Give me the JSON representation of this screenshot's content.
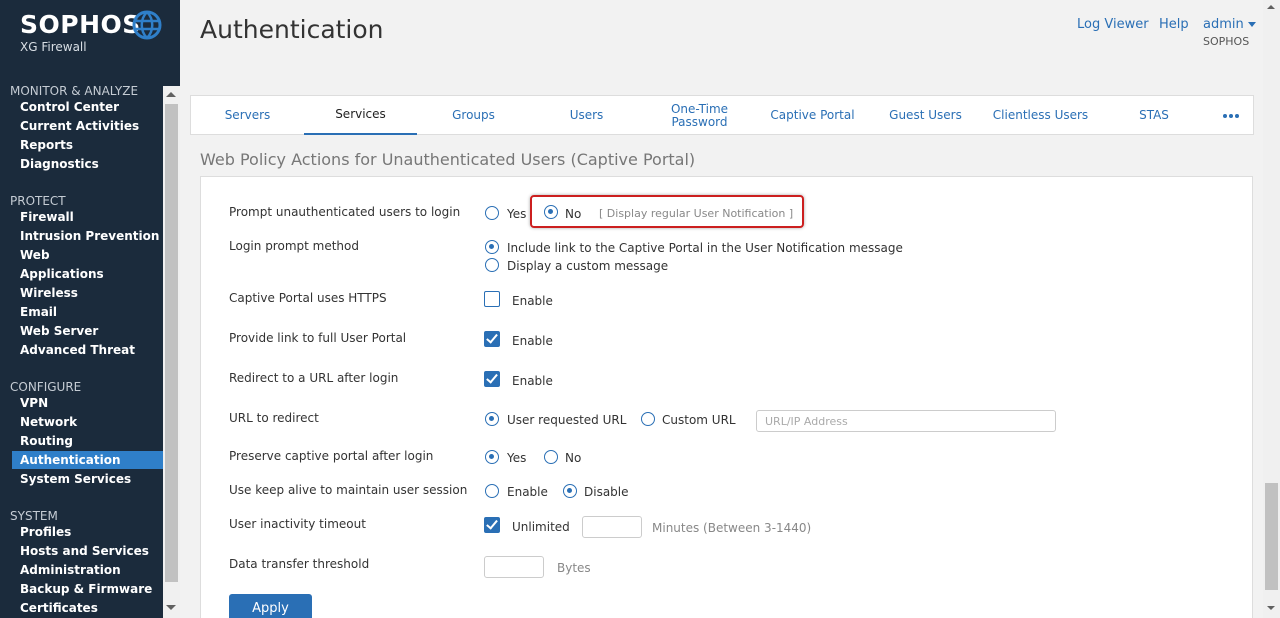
{
  "brand": {
    "name": "SOPHOS",
    "product": "XG Firewall"
  },
  "header": {
    "title": "Authentication",
    "log_viewer": "Log Viewer",
    "help": "Help",
    "admin": "admin",
    "org": "SOPHOS"
  },
  "sidebar": {
    "sections": [
      {
        "title": "MONITOR & ANALYZE",
        "items": [
          "Control Center",
          "Current Activities",
          "Reports",
          "Diagnostics"
        ]
      },
      {
        "title": "PROTECT",
        "items": [
          "Firewall",
          "Intrusion Prevention",
          "Web",
          "Applications",
          "Wireless",
          "Email",
          "Web Server",
          "Advanced Threat"
        ]
      },
      {
        "title": "CONFIGURE",
        "items": [
          "VPN",
          "Network",
          "Routing",
          "Authentication",
          "System Services"
        ]
      },
      {
        "title": "SYSTEM",
        "items": [
          "Profiles",
          "Hosts and Services",
          "Administration",
          "Backup & Firmware",
          "Certificates"
        ]
      }
    ],
    "active_item": "Authentication"
  },
  "tabs": [
    "Servers",
    "Services",
    "Groups",
    "Users",
    "One-Time Password",
    "Captive Portal",
    "Guest Users",
    "Clientless Users",
    "STAS"
  ],
  "active_tab": "Services",
  "section_title": "Web Policy Actions for Unauthenticated Users (Captive Portal)",
  "form": {
    "prompt_login": {
      "label": "Prompt unauthenticated users to login",
      "yes": "Yes",
      "no": "No",
      "selected": "No",
      "hint": "[ Display regular User Notification ]"
    },
    "login_method": {
      "label": "Login prompt method",
      "opt1": "Include link to the Captive Portal in the User Notification message",
      "opt2": "Display a custom message",
      "selected": "opt1"
    },
    "https": {
      "label": "Captive Portal uses HTTPS",
      "text": "Enable",
      "checked": false
    },
    "user_portal": {
      "label": "Provide link to full User Portal",
      "text": "Enable",
      "checked": true
    },
    "redirect": {
      "label": "Redirect to a URL after login",
      "text": "Enable",
      "checked": true
    },
    "url_redirect": {
      "label": "URL to redirect",
      "opt1": "User requested URL",
      "opt2": "Custom URL",
      "selected": "opt1",
      "placeholder": "URL/IP Address"
    },
    "preserve": {
      "label": "Preserve captive portal after login",
      "yes": "Yes",
      "no": "No",
      "selected": "Yes"
    },
    "keep_alive": {
      "label": "Use keep alive to maintain user session",
      "enable": "Enable",
      "disable": "Disable",
      "selected": "Disable"
    },
    "inactivity": {
      "label": "User inactivity timeout",
      "text": "Unlimited",
      "checked": true,
      "unit": "Minutes (Between 3-1440)"
    },
    "threshold": {
      "label": "Data transfer threshold",
      "unit": "Bytes"
    }
  },
  "apply_label": "Apply",
  "colors": {
    "sidebar_bg": "#1b2b3c",
    "accent": "#2a6fb5",
    "highlight": "#cc1f1f"
  }
}
